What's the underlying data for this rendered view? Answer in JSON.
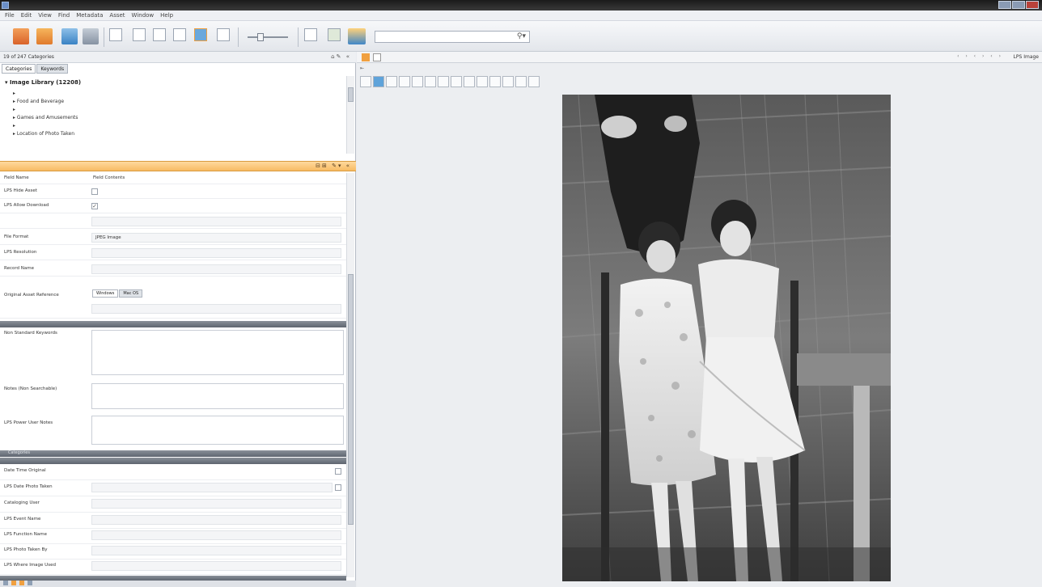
{
  "window": {
    "title": ""
  },
  "menu": [
    "File",
    "Edit",
    "View",
    "Find",
    "Metadata",
    "Asset",
    "Window",
    "Help"
  ],
  "toolbar": {
    "search_placeholder": ""
  },
  "left_panel": {
    "header": "19 of 247 Categories",
    "tabs": [
      "Categories",
      "Keywords"
    ],
    "tree": {
      "root": "Image Library (12208)",
      "items": [
        "",
        "Food and Beverage",
        "",
        "Games and Amusements",
        "",
        "Location of Photo Taken"
      ]
    }
  },
  "info": {
    "header": "",
    "fields": [
      {
        "label": "Field Name",
        "value": "Field Contents"
      },
      {
        "label": "LPS Hide Asset",
        "value": ""
      },
      {
        "label": "LPS Allow Download",
        "value": ""
      },
      {
        "label": "",
        "value": ""
      },
      {
        "label": "File Format",
        "value": "JPEG Image"
      },
      {
        "label": "LPS Resolution",
        "value": ""
      },
      {
        "label": "Record Name",
        "value": ""
      }
    ],
    "original_ref_label": "Original Asset Reference",
    "os_tabs": [
      "Windows",
      "Mac OS"
    ],
    "original_ref_value": "",
    "section_keywords": "",
    "nonstd_label": "Non Standard Keywords",
    "notes_label": "Notes (Non Searchable)",
    "notes_value": "",
    "power_label": "LPS Power User Notes",
    "section_categories": "Categories",
    "section_custom": "",
    "fields2": [
      {
        "label": "Date Time Original",
        "value": ""
      },
      {
        "label": "LPS Date Photo Taken",
        "value": ""
      },
      {
        "label": "Cataloging User",
        "value": ""
      },
      {
        "label": "LPS Event Name",
        "value": ""
      },
      {
        "label": "LPS Function Name",
        "value": ""
      },
      {
        "label": "LPS Photo Taken By",
        "value": ""
      },
      {
        "label": "LPS Where Image Used",
        "value": ""
      }
    ]
  },
  "viewer": {
    "filename": "",
    "lps_label": "LPS Image",
    "photo_alt": ""
  },
  "colors": {
    "info_header": "#f7bb63",
    "accent": "#f7a94b"
  }
}
